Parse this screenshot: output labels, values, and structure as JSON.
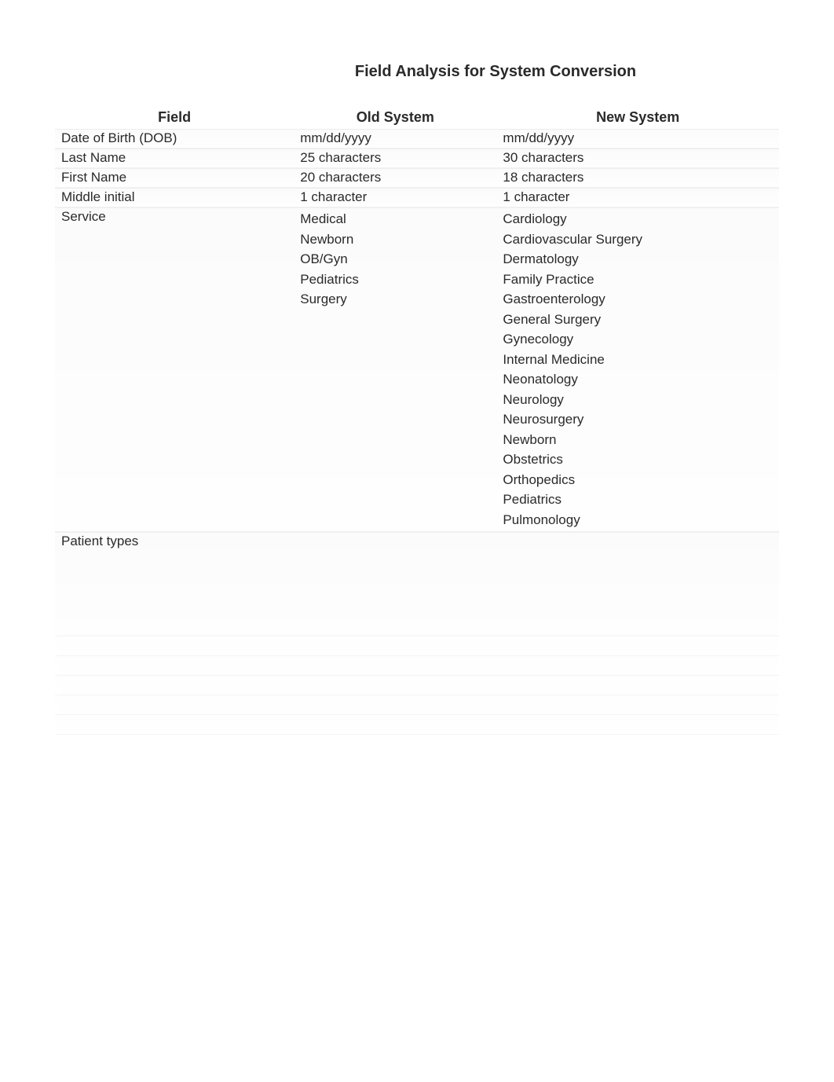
{
  "title": "Field Analysis for System Conversion",
  "headers": {
    "field": "Field",
    "old": "Old System",
    "new": "New System"
  },
  "rows": [
    {
      "field": "Date of Birth (DOB)",
      "old": [
        "mm/dd/yyyy"
      ],
      "new": [
        "mm/dd/yyyy"
      ]
    },
    {
      "field": "Last Name",
      "old": [
        "25 characters"
      ],
      "new": [
        "30 characters"
      ]
    },
    {
      "field": "First Name",
      "old": [
        "20 characters"
      ],
      "new": [
        "18 characters"
      ]
    },
    {
      "field": "Middle initial",
      "old": [
        "1 character"
      ],
      "new": [
        "1 character"
      ]
    },
    {
      "field": "Service",
      "old": [
        "Medical",
        "Newborn",
        "OB/Gyn",
        "Pediatrics",
        "Surgery"
      ],
      "new": [
        "Cardiology",
        "Cardiovascular Surgery",
        "Dermatology",
        "Family Practice",
        "Gastroenterology",
        "General Surgery",
        "Gynecology",
        "Internal Medicine",
        "Neonatology",
        "Neurology",
        "Neurosurgery",
        "Newborn",
        "Obstetrics",
        "Orthopedics",
        "Pediatrics",
        "Pulmonology"
      ]
    },
    {
      "field": "Patient types",
      "old": [
        "",
        "",
        ""
      ],
      "new": [
        "",
        "",
        "",
        "",
        ""
      ],
      "blurred": true
    }
  ],
  "blurredRows": [
    {
      "field": "",
      "old": "",
      "new": ""
    },
    {
      "field": "",
      "old": "",
      "new": ""
    },
    {
      "field": "",
      "old": "",
      "new": ""
    },
    {
      "field": "",
      "old": "",
      "new": ""
    },
    {
      "field": "",
      "old": "",
      "new": ""
    }
  ]
}
